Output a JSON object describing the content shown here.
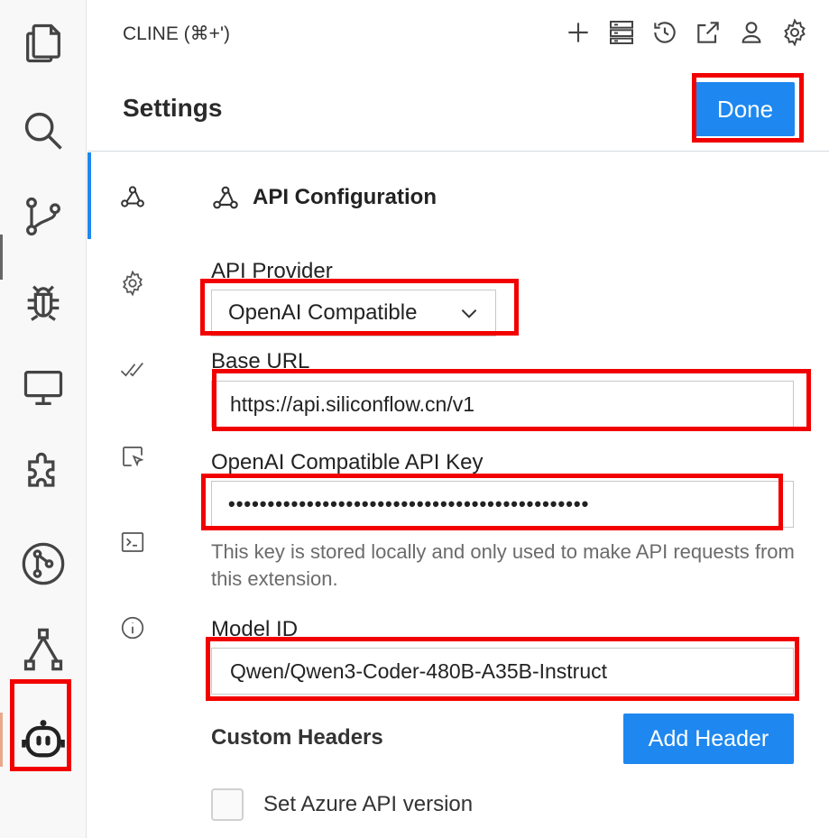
{
  "header": {
    "title": "CLINE (⌘+')",
    "icons": [
      "plus-icon",
      "server-icon",
      "history-icon",
      "popout-icon",
      "account-icon",
      "gear-icon"
    ]
  },
  "settings": {
    "title": "Settings",
    "done_label": "Done"
  },
  "section": {
    "title": "API Configuration"
  },
  "fields": {
    "provider_label": "API Provider",
    "provider_value": "OpenAI Compatible",
    "base_url_label": "Base URL",
    "base_url_value": "https://api.siliconflow.cn/v1",
    "api_key_label": "OpenAI Compatible API Key",
    "api_key_masked": "••••••••••••••••••••••••••••••••••••••••••••••",
    "api_key_help": "This key is stored locally and only used to make API requests from this extension.",
    "model_label": "Model ID",
    "model_value": "Qwen/Qwen3-Coder-480B-A35B-Instruct",
    "custom_headers_label": "Custom Headers",
    "add_header_label": "Add Header",
    "azure_label": "Set Azure API version"
  },
  "colors": {
    "accent": "#1e88f0",
    "highlight": "#f20000"
  }
}
